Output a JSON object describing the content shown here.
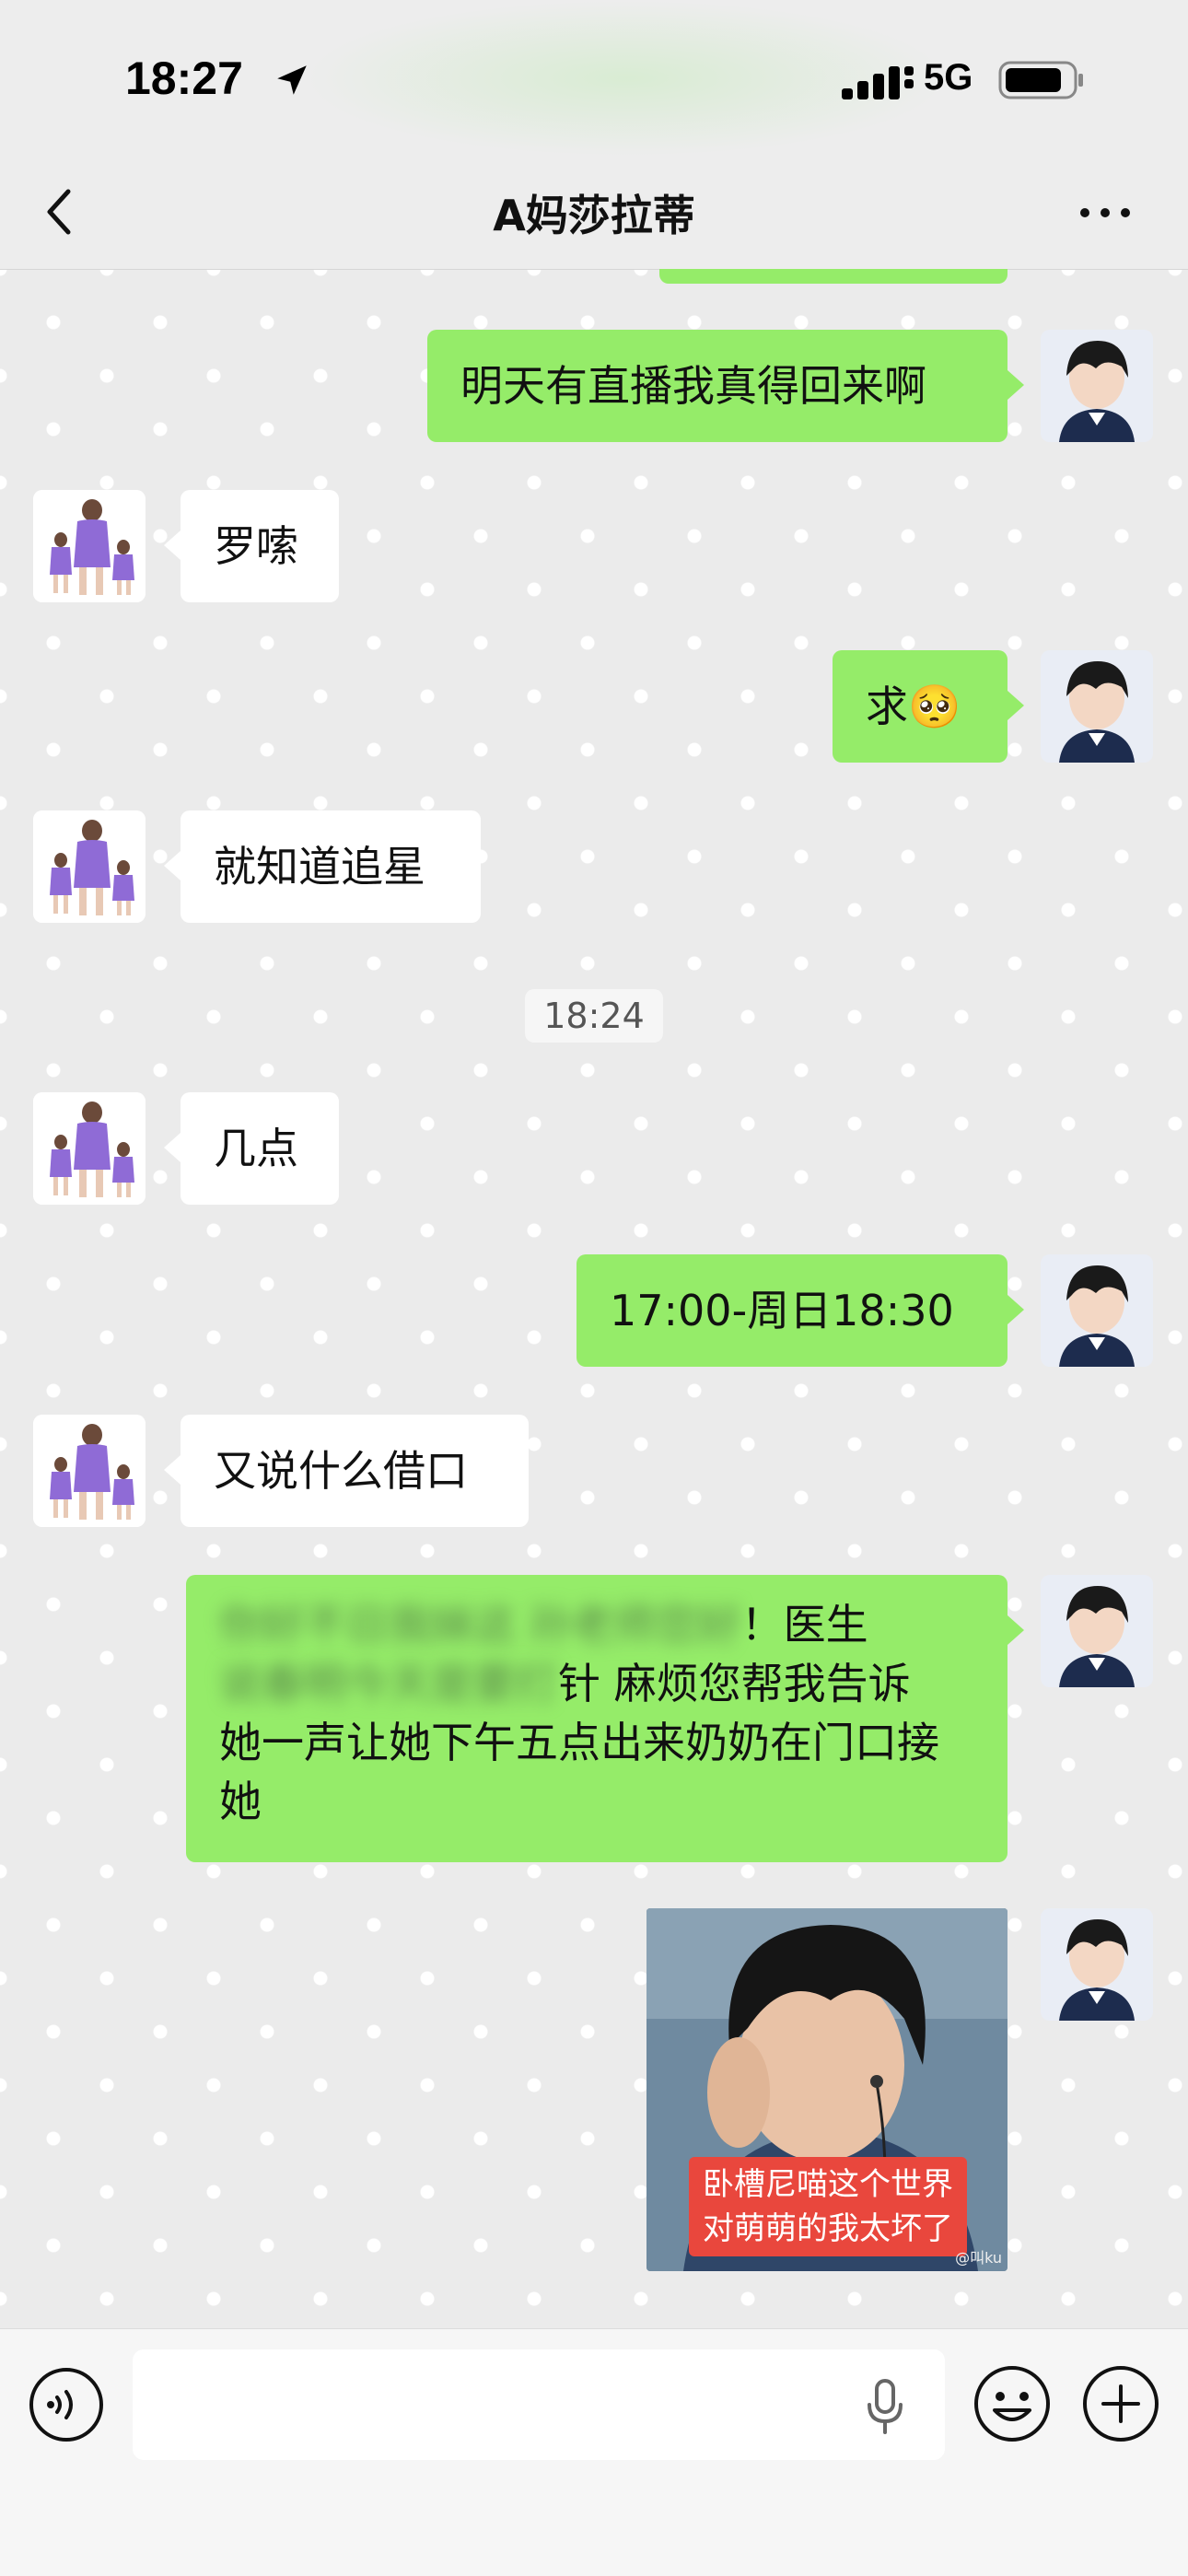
{
  "status_bar": {
    "time": "18:27",
    "network": "5G"
  },
  "nav": {
    "title": "A妈莎拉蒂"
  },
  "messages": [
    {
      "side": "right",
      "text": "明天有直播我真得回来啊"
    },
    {
      "side": "left",
      "text": "罗嗦"
    },
    {
      "side": "right",
      "text": "求🥺"
    },
    {
      "side": "left",
      "text": "就知道追星"
    },
    {
      "side": "left",
      "text": "几点"
    },
    {
      "side": "right",
      "text": "17:00-周日18:30"
    },
    {
      "side": "left",
      "text": "又说什么借口"
    },
    {
      "side": "right",
      "blurred_text": "你好不日我妹这 孙老师您好",
      "text_line1": "！医生",
      "blurred_text2": "说春明今天是要打",
      "text_line2": "针 麻烦您帮我告诉",
      "text_rest": "她一声让她下午五点出来奶奶在门口接她"
    }
  ],
  "timestamp": "18:24",
  "sticker": {
    "caption": "卧槽尼喵这个世界对萌萌的我太坏了",
    "watermark": "@叫ku"
  },
  "input_bar": {
    "placeholder": ""
  },
  "colors": {
    "bubble_right": "#95ec69",
    "bubble_left": "#ffffff",
    "chat_bg": "#ebebeb"
  }
}
